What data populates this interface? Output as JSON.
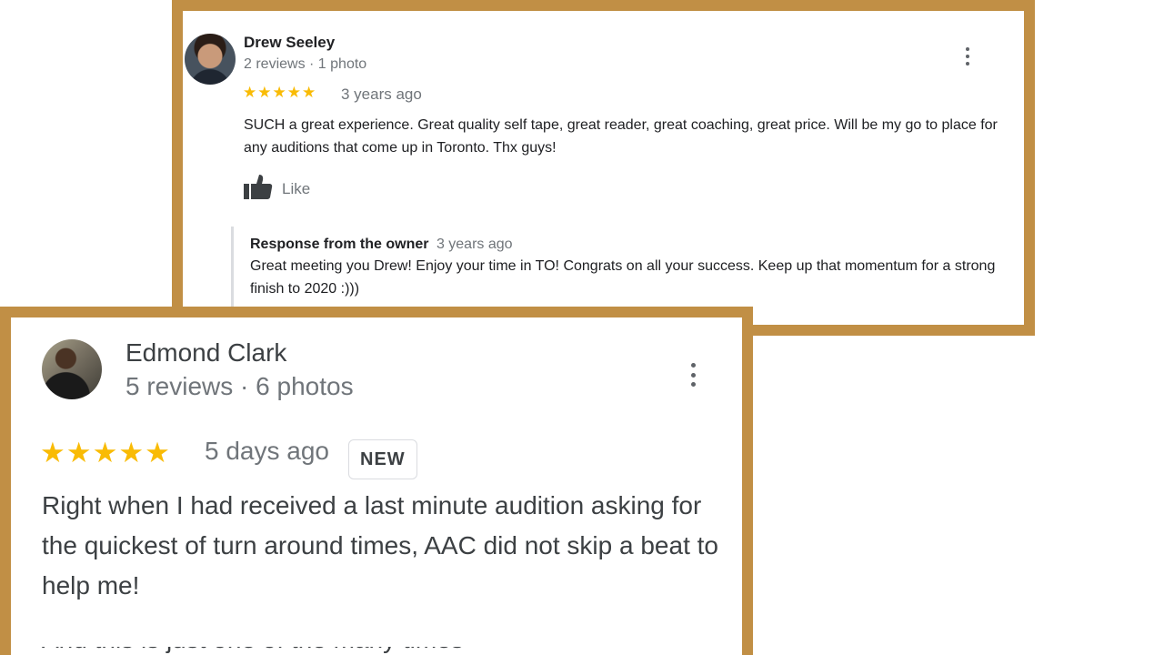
{
  "reviews": [
    {
      "author": "Drew Seeley",
      "meta": "2 reviews · 1 photo",
      "stars": "★★★★★",
      "rating": 5,
      "date": "3 years ago",
      "text": "SUCH a great experience. Great quality self tape, great reader, great coaching, great price. Will be my go to place for any auditions that come up in Toronto. Thx guys!",
      "like_label": "Like",
      "owner_response": {
        "label": "Response from the owner",
        "date": "3 years ago",
        "text": "Great meeting you Drew! Enjoy your time in TO! Congrats on all your success. Keep up that momentum for a strong finish to 2020 :)))"
      }
    },
    {
      "author": "Edmond Clark",
      "meta": "5 reviews · 6 photos",
      "stars": "★★★★★",
      "rating": 5,
      "date": "5 days ago",
      "badge": "NEW",
      "text": "Right when I had received a last minute audition asking for the quickest of turn around times, AAC did not skip a beat to help me!"
    }
  ],
  "colors": {
    "frame": "#c18f45",
    "star": "#f9bb05",
    "text": "#202124",
    "muted": "#70757a"
  },
  "icons": {
    "more": "more-vert-icon",
    "like": "thumbs-up-icon"
  }
}
